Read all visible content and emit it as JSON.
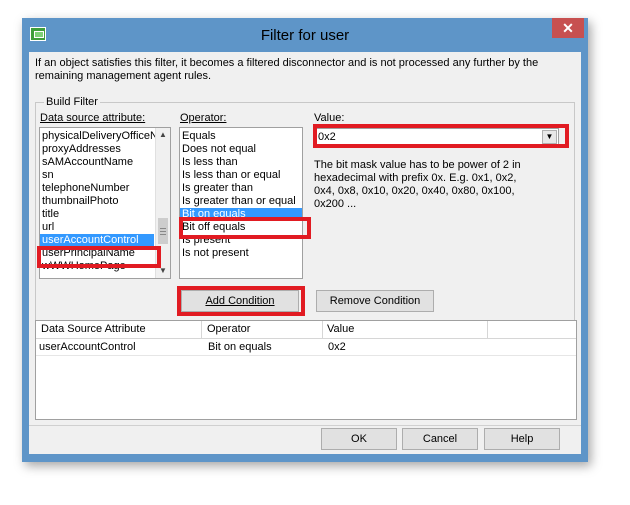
{
  "window": {
    "title": "Filter for user",
    "close_glyph": "✕"
  },
  "description": "If an object satisfies this filter, it becomes a filtered disconnector and is not processed any further by the remaining management agent rules.",
  "build_filter": {
    "legend": "Build Filter",
    "data_source_label": "Data source attribute:",
    "operator_label": "Operator:",
    "value_label": "Value:",
    "attributes": [
      "physicalDeliveryOfficeN",
      "proxyAddresses",
      "sAMAccountName",
      "sn",
      "telephoneNumber",
      "thumbnailPhoto",
      "title",
      "url",
      "userAccountControl",
      "userPrincipalName",
      "wWWHomePage"
    ],
    "selected_attribute": "userAccountControl",
    "operators": [
      "Equals",
      "Does not equal",
      "Is less than",
      "Is less than or equal",
      "Is greater than",
      "Is greater than or equal",
      "Bit on equals",
      "Bit off equals",
      "Is present",
      "Is not present"
    ],
    "selected_operator": "Bit on equals",
    "value": "0x2",
    "hint": "The bit mask value has to be power of 2 in hexadecimal with prefix 0x. E.g. 0x1, 0x2, 0x4, 0x8, 0x10, 0x20, 0x40, 0x80, 0x100, 0x200 ..."
  },
  "buttons": {
    "add_condition": "Add Condition",
    "remove_condition": "Remove Condition",
    "ok": "OK",
    "cancel": "Cancel",
    "help": "Help"
  },
  "conditions": {
    "headers": [
      "Data Source Attribute",
      "Operator",
      "Value"
    ],
    "rows": [
      [
        "userAccountControl",
        "Bit on equals",
        "0x2"
      ]
    ]
  },
  "colors": {
    "title_bar": "#5e95c8",
    "highlight": "#e11b22",
    "selection": "#3399ff"
  },
  "icons": {
    "app": "filter-app-icon",
    "close": "close-icon",
    "dropdown": "chevron-down-icon"
  }
}
